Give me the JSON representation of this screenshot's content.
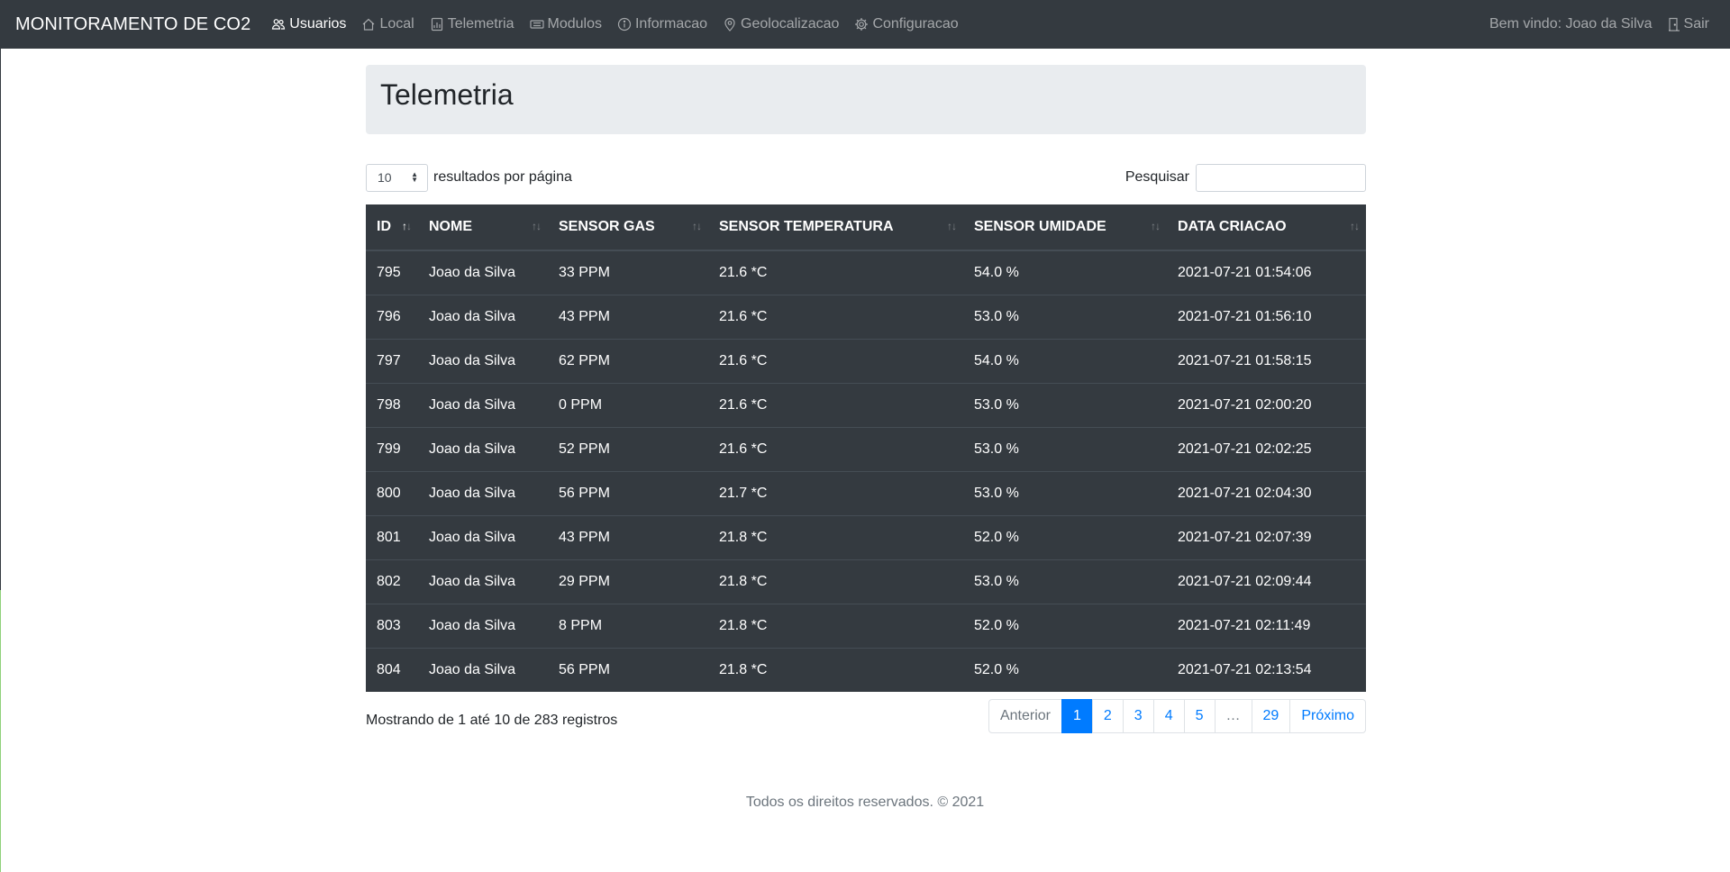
{
  "navbar": {
    "brand": "MONITORAMENTO DE CO2",
    "items": [
      {
        "label": "Usuarios",
        "icon": "users-icon",
        "active": true
      },
      {
        "label": "Local",
        "icon": "home-icon",
        "active": false
      },
      {
        "label": "Telemetria",
        "icon": "chart-icon",
        "active": false
      },
      {
        "label": "Modulos",
        "icon": "modules-icon",
        "active": false
      },
      {
        "label": "Informacao",
        "icon": "info-icon",
        "active": false
      },
      {
        "label": "Geolocalizacao",
        "icon": "location-pin-icon",
        "active": false
      },
      {
        "label": "Configuracao",
        "icon": "gear-icon",
        "active": false
      }
    ],
    "welcome": "Bem vindo: Joao da Silva",
    "logout": "Sair"
  },
  "page": {
    "title": "Telemetria"
  },
  "controls": {
    "page_length": "10",
    "page_length_label": "resultados por página",
    "search_label": "Pesquisar",
    "search_value": ""
  },
  "table": {
    "columns": [
      "ID",
      "NOME",
      "SENSOR GAS",
      "SENSOR TEMPERATURA",
      "SENSOR UMIDADE",
      "DATA CRIACAO"
    ],
    "rows": [
      [
        "795",
        "Joao da Silva",
        "33 PPM",
        "21.6 *C",
        "54.0 %",
        "2021-07-21 01:54:06"
      ],
      [
        "796",
        "Joao da Silva",
        "43 PPM",
        "21.6 *C",
        "53.0 %",
        "2021-07-21 01:56:10"
      ],
      [
        "797",
        "Joao da Silva",
        "62 PPM",
        "21.6 *C",
        "54.0 %",
        "2021-07-21 01:58:15"
      ],
      [
        "798",
        "Joao da Silva",
        "0 PPM",
        "21.6 *C",
        "53.0 %",
        "2021-07-21 02:00:20"
      ],
      [
        "799",
        "Joao da Silva",
        "52 PPM",
        "21.6 *C",
        "53.0 %",
        "2021-07-21 02:02:25"
      ],
      [
        "800",
        "Joao da Silva",
        "56 PPM",
        "21.7 *C",
        "53.0 %",
        "2021-07-21 02:04:30"
      ],
      [
        "801",
        "Joao da Silva",
        "43 PPM",
        "21.8 *C",
        "52.0 %",
        "2021-07-21 02:07:39"
      ],
      [
        "802",
        "Joao da Silva",
        "29 PPM",
        "21.8 *C",
        "53.0 %",
        "2021-07-21 02:09:44"
      ],
      [
        "803",
        "Joao da Silva",
        "8 PPM",
        "21.8 *C",
        "52.0 %",
        "2021-07-21 02:11:49"
      ],
      [
        "804",
        "Joao da Silva",
        "56 PPM",
        "21.8 *C",
        "52.0 %",
        "2021-07-21 02:13:54"
      ]
    ]
  },
  "pagination": {
    "info": "Mostrando de 1 até 10 de 283 registros",
    "previous": "Anterior",
    "pages": [
      "1",
      "2",
      "3",
      "4",
      "5",
      "…",
      "29"
    ],
    "active_page": "1",
    "next": "Próximo"
  },
  "footer": {
    "text": "Todos os direitos reservados. © 2021"
  },
  "colors": {
    "navbar_bg": "#343a40",
    "table_bg": "#343a40",
    "jumbotron_bg": "#e9ecef",
    "accent": "#007bff"
  }
}
